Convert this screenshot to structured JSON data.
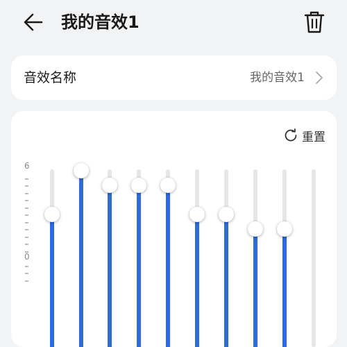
{
  "header": {
    "title": "我的音效1",
    "back_icon": "arrow-left-icon",
    "delete_icon": "trash-icon"
  },
  "name_row": {
    "label": "音效名称",
    "value": "我的音效1",
    "chevron_icon": "chevron-right-icon"
  },
  "equalizer": {
    "reset_label": "重置",
    "reset_icon": "reset-icon",
    "scale_top": "6",
    "scale_mid": "0",
    "max_level": 6,
    "accent": "#2f6bd8",
    "bands": [
      {
        "level": 3
      },
      {
        "level": 6
      },
      {
        "level": 5
      },
      {
        "level": 5
      },
      {
        "level": 5
      },
      {
        "level": 3
      },
      {
        "level": 3
      },
      {
        "level": 2
      },
      {
        "level": 2
      },
      {
        "level": 0
      }
    ]
  }
}
